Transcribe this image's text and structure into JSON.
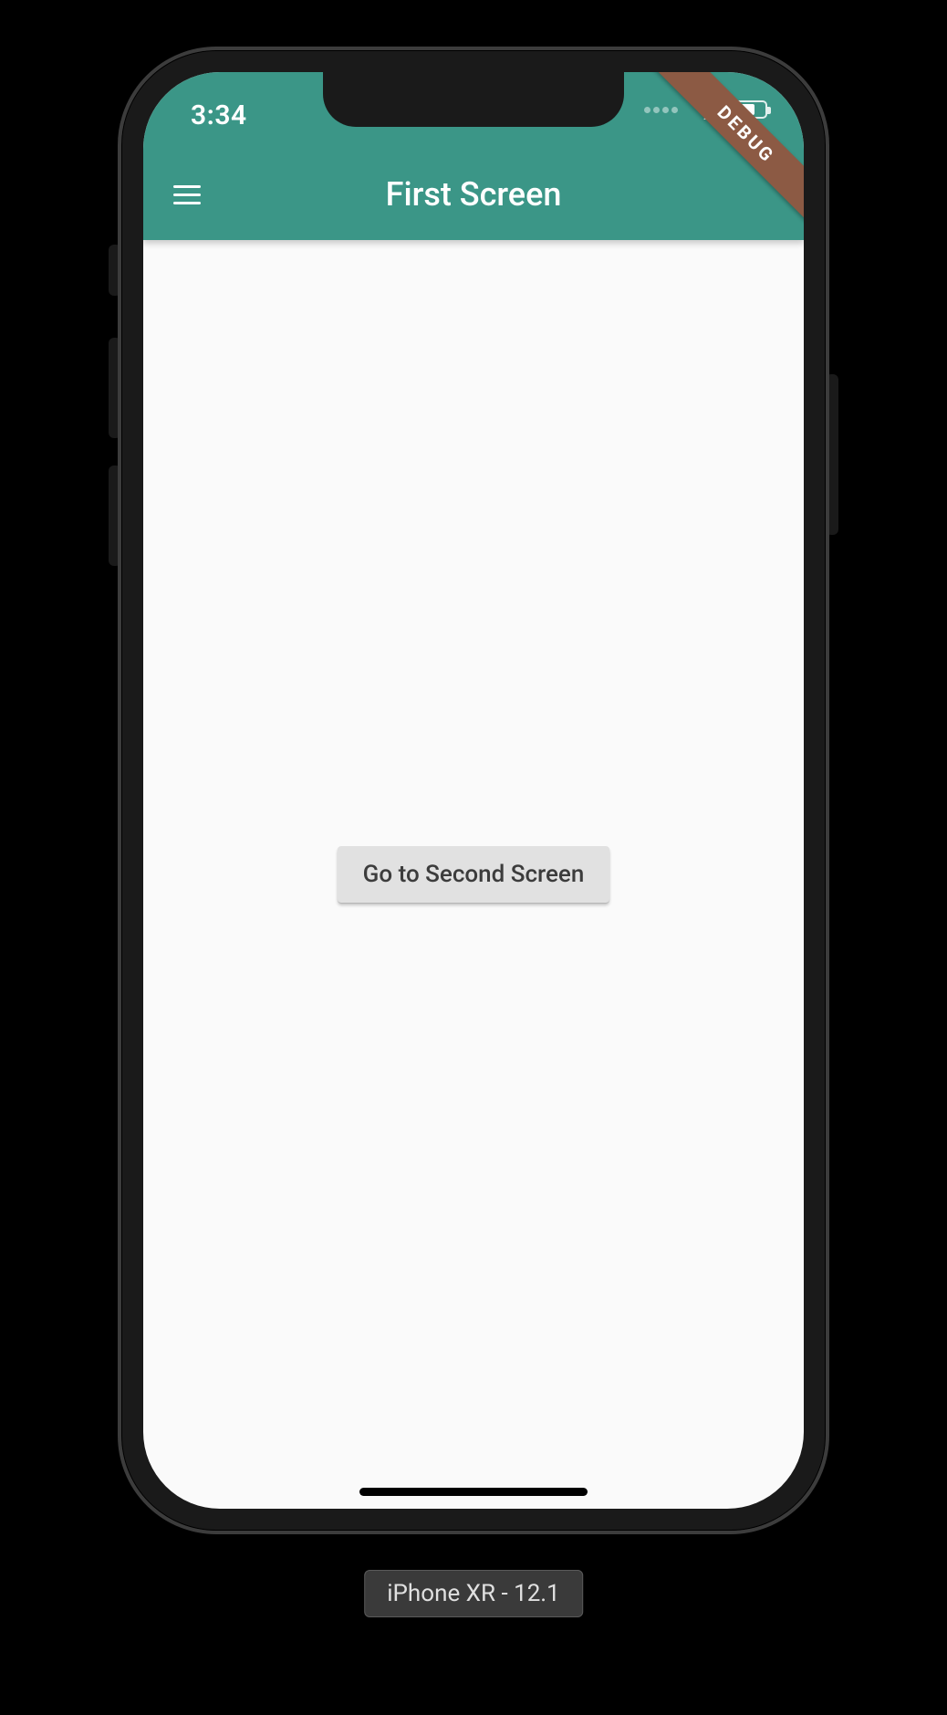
{
  "status": {
    "time": "3:34"
  },
  "appbar": {
    "title": "First Screen"
  },
  "body": {
    "button_label": "Go to Second Screen"
  },
  "debug": {
    "label": "DEBUG"
  },
  "caption": {
    "text": "iPhone XR - 12.1"
  },
  "colors": {
    "primary": "#3b9687",
    "scaffold": "#fafafa",
    "button_bg": "#e1e1e1"
  }
}
